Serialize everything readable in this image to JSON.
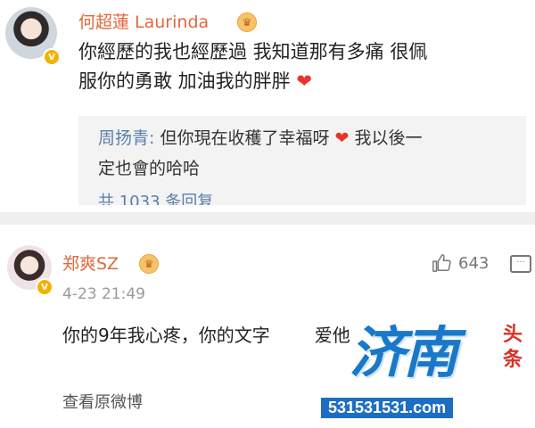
{
  "comment1": {
    "username": "何超蓮 Laurinda",
    "text_line1": "你經歷的我也經歷過 我知道那有多痛 很佩",
    "text_line2": "服你的勇敢 加油我的胖胖",
    "heart": "❤",
    "reply": {
      "author": "周扬青:",
      "text_part1": " 但你現在收穫了幸福呀 ",
      "heart": "❤",
      "text_part2": " 我以後一",
      "text_line2": "定也會的哈哈",
      "more_partial": "共 1033 条回复"
    }
  },
  "comment2": {
    "username": "郑爽SZ",
    "timestamp": "4-23 21:49",
    "like_count": "643",
    "text": "你的9年我心疼，你的文字",
    "text_tail": "爱他",
    "view_original": "查看原微博"
  },
  "watermark": {
    "logo": "济南",
    "side": "头条",
    "url": "531531531.com"
  },
  "colors": {
    "username": "#e0683c",
    "reply_author": "#5b7fa8",
    "heart": "#e8352b",
    "watermark_blue": "#1d6ec2",
    "watermark_red": "#d9322a"
  }
}
